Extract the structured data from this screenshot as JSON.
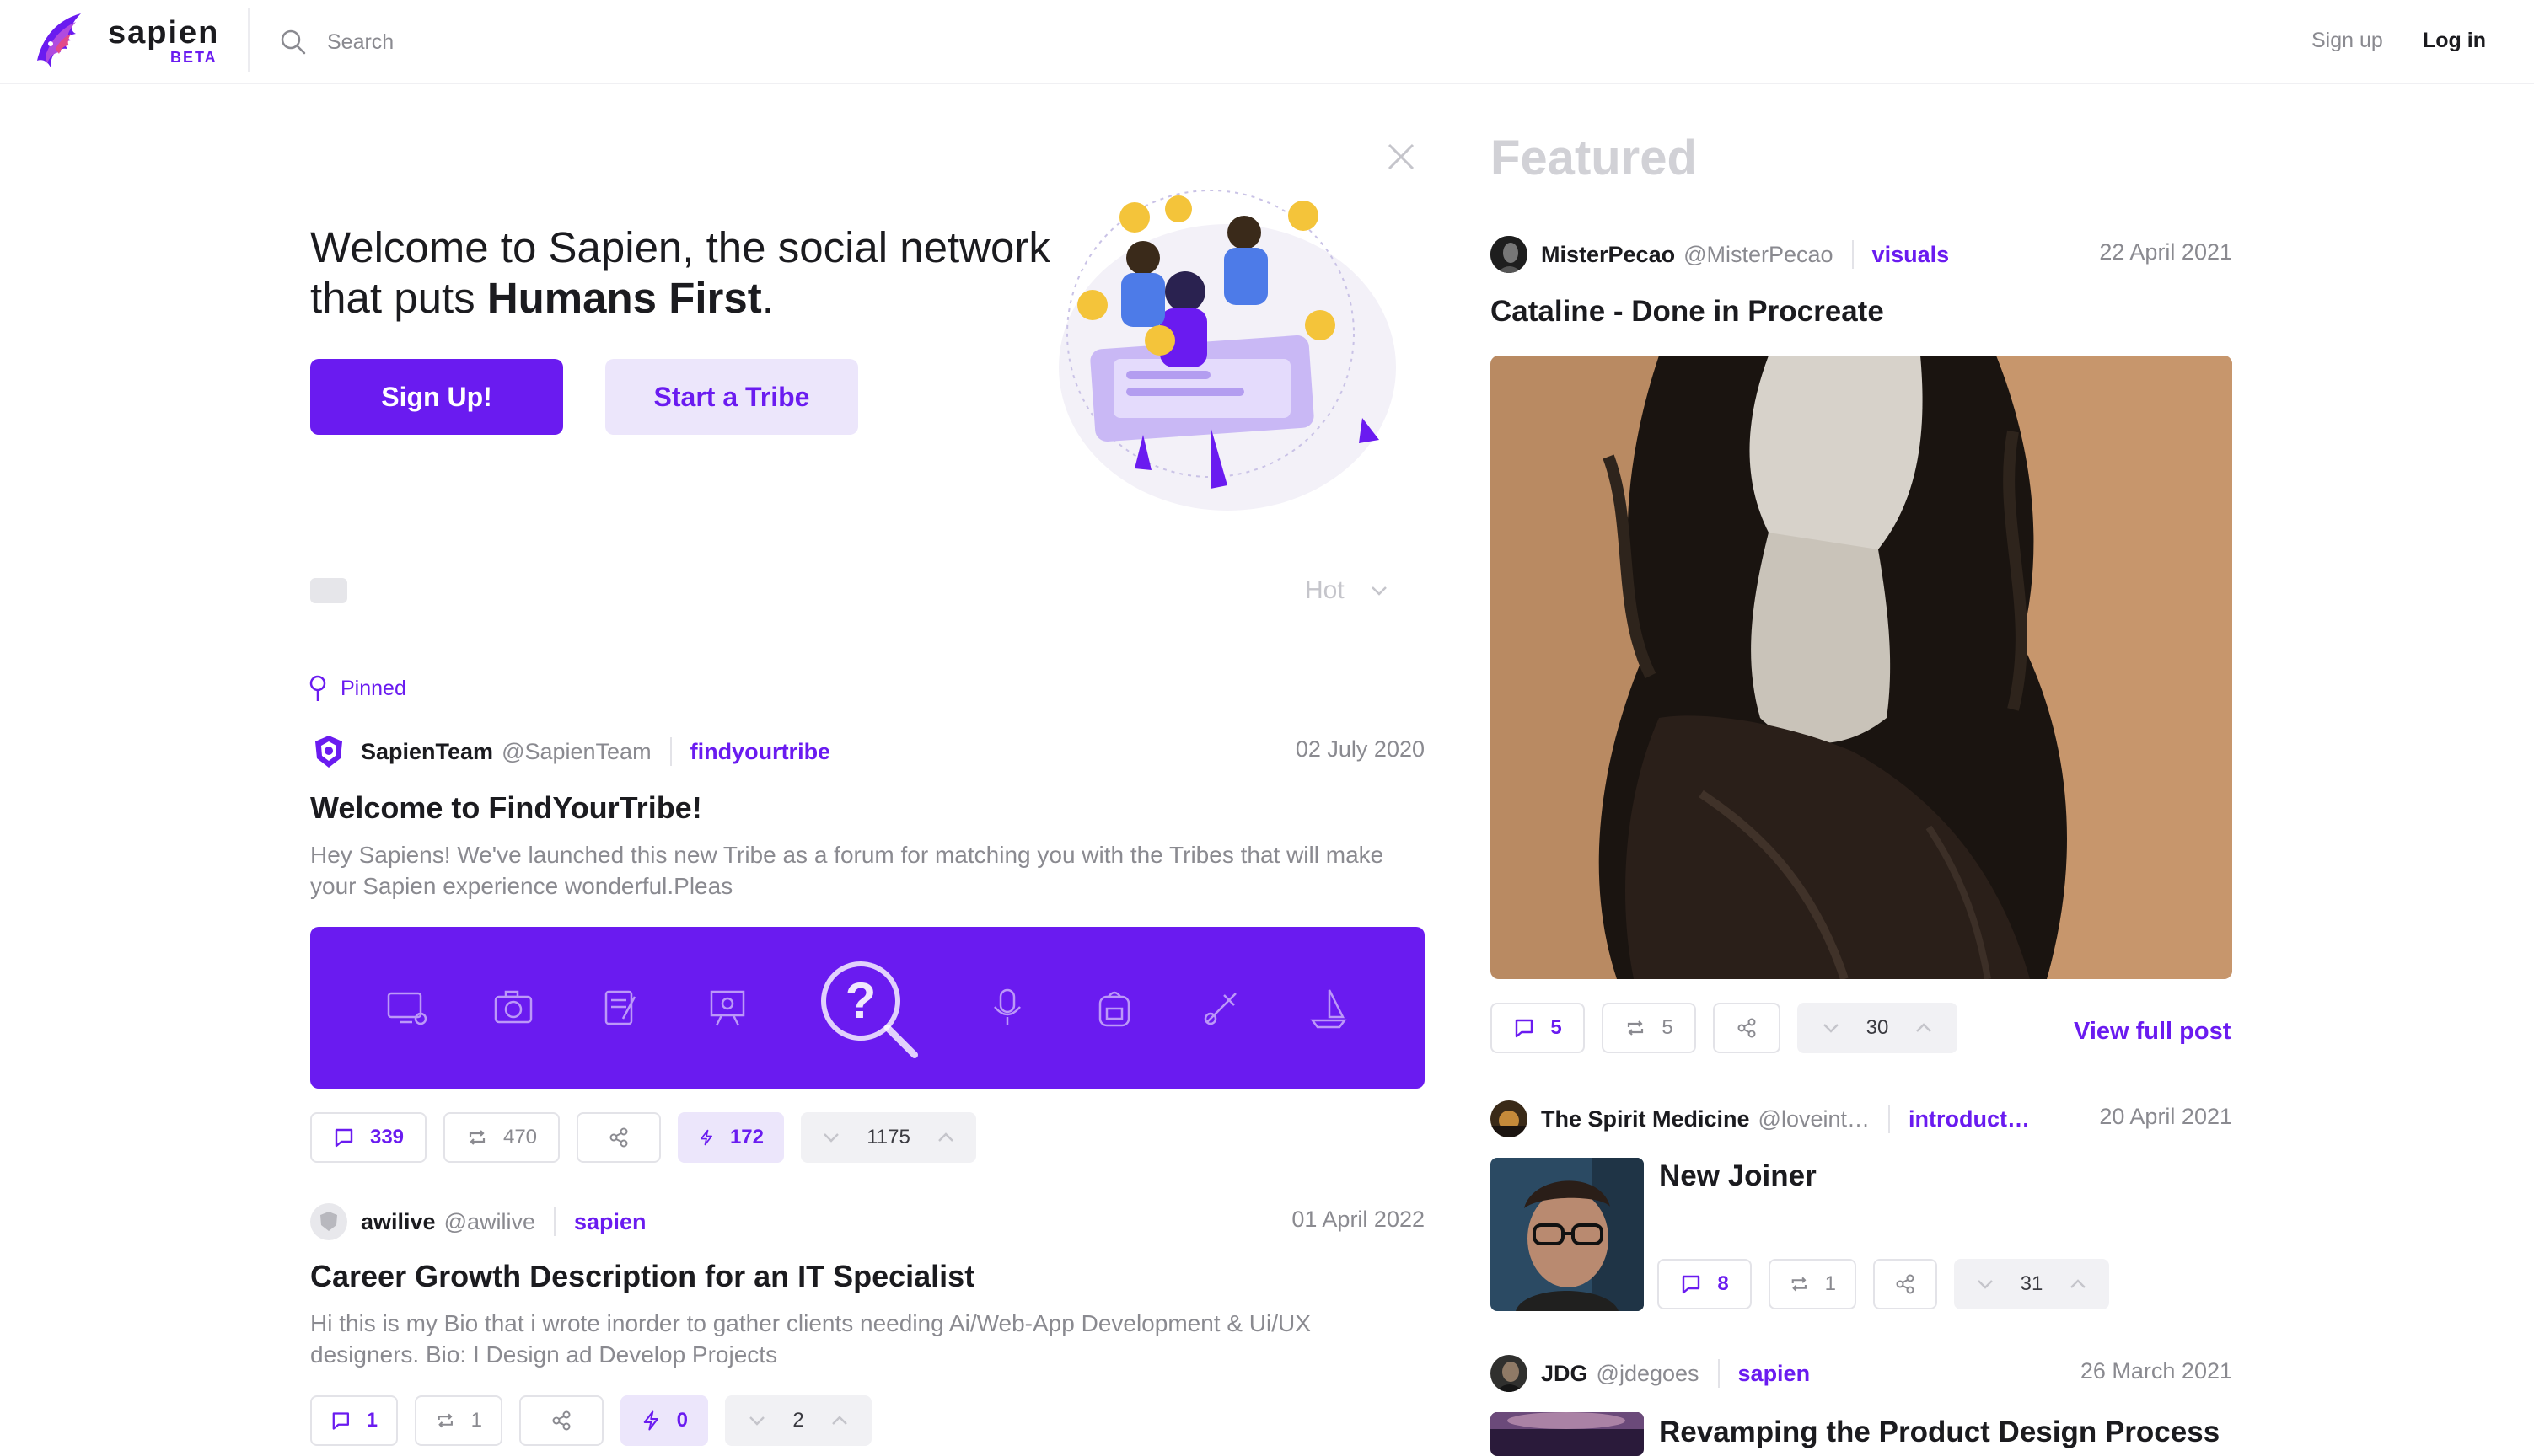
{
  "header": {
    "brand": "sapien",
    "beta": "BETA",
    "search_placeholder": "Search",
    "signup": "Sign up",
    "login": "Log in"
  },
  "hero": {
    "title_part1": "Welcome to Sapien, the social network that puts ",
    "title_bold": "Humans First",
    "title_end": ".",
    "signup_button": "Sign Up!",
    "tribe_button": "Start a Tribe"
  },
  "feed": {
    "sort": "Hot",
    "pinned_label": "Pinned",
    "posts": [
      {
        "user": "SapienTeam",
        "handle": "@SapienTeam",
        "tribe": "findyourtribe",
        "date": "02 July 2020",
        "title": "Welcome to FindYourTribe!",
        "excerpt": "Hey Sapiens! We've launched this new Tribe as a forum for matching you with the Tribes that will make your Sapien experience wonderful.Pleas",
        "comments": "339",
        "reposts": "470",
        "boosts": "172",
        "votes": "1175"
      },
      {
        "user": "awilive",
        "handle": "@awilive",
        "tribe": "sapien",
        "date": "01 April 2022",
        "title": "Career Growth Description for an IT Specialist",
        "excerpt": "Hi this is my Bio that i wrote inorder to gather clients needing Ai/Web-App Development & Ui/UX designers. Bio: I Design ad Develop Projects",
        "comments": "1",
        "reposts": "1",
        "boosts": "0",
        "votes": "2"
      }
    ]
  },
  "featured": {
    "heading": "Featured",
    "view_full": "View full post",
    "items": [
      {
        "user": "MisterPecao",
        "handle": "@MisterPecao",
        "tribe": "visuals",
        "date": "22 April 2021",
        "title": "Cataline - Done in Procreate",
        "comments": "5",
        "reposts": "5",
        "votes": "30"
      },
      {
        "user": "The Spirit Medicine",
        "handle": "@loveint…",
        "tribe": "introduct…",
        "date": "20 April 2021",
        "title": "New Joiner",
        "comments": "8",
        "reposts": "1",
        "votes": "31"
      },
      {
        "user": "JDG",
        "handle": "@jdegoes",
        "tribe": "sapien",
        "date": "26 March 2021",
        "title": "Revamping the Product Design Process"
      }
    ]
  },
  "colors": {
    "accent": "#6a1bf0",
    "accent_soft": "#ece6fb",
    "muted_text": "#8a8a90"
  },
  "icons": [
    "search-icon",
    "close-icon",
    "pin-icon",
    "chevron-down-icon",
    "comment-icon",
    "repost-icon",
    "share-icon",
    "bolt-icon",
    "chevron-up-icon",
    "question-search-icon"
  ]
}
